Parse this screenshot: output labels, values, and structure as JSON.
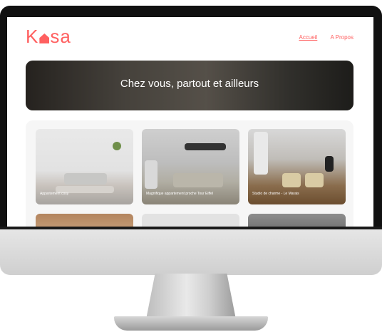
{
  "app": {
    "logo": {
      "before": "K",
      "after": "sa"
    },
    "nav": {
      "home": "Accueil",
      "about": "A Propos"
    }
  },
  "banner": {
    "title": "Chez vous, partout et ailleurs"
  },
  "listings": [
    {
      "title": "Appartement cosy"
    },
    {
      "title": "Magnifique appartement proche Tour Eiffel"
    },
    {
      "title": "Studio de charme - Le Marais"
    }
  ],
  "colors": {
    "accent": "#ff6060",
    "bezel": "#111111"
  }
}
